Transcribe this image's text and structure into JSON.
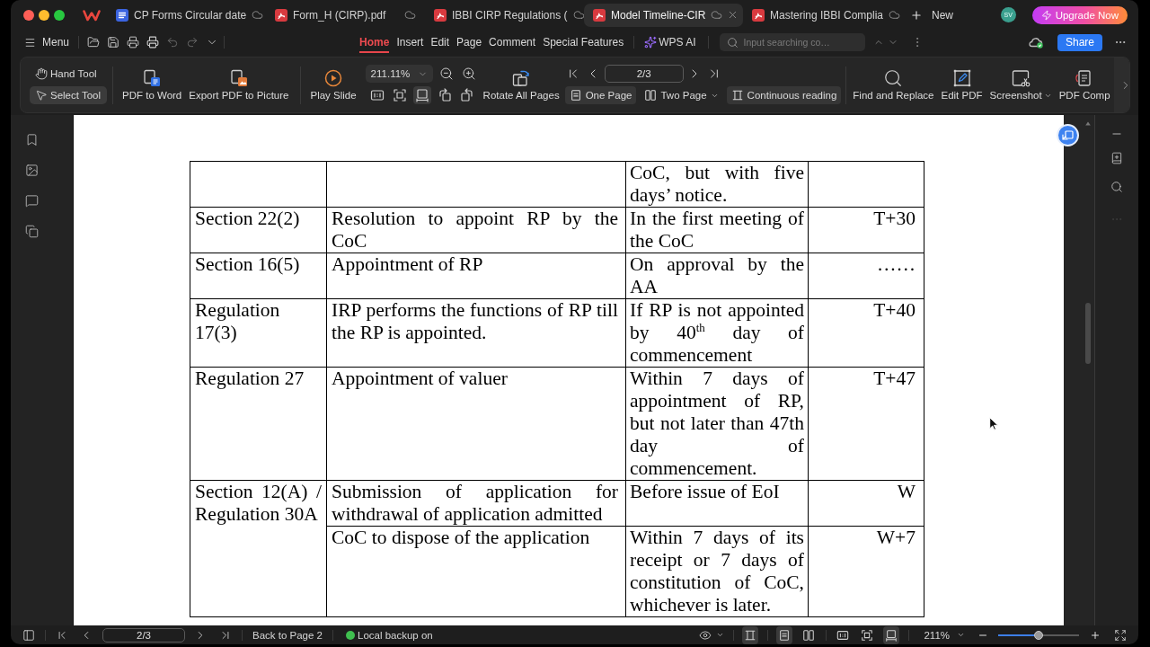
{
  "tabs": [
    {
      "label": "CP Forms Circular date",
      "kind": "word",
      "selected": false
    },
    {
      "label": "Form_H (CIRP).pdf",
      "kind": "pdf",
      "selected": false
    },
    {
      "label": "IBBI CIRP Regulations (",
      "kind": "pdf",
      "selected": false
    },
    {
      "label": "Model Timeline-CIR",
      "kind": "pdf",
      "selected": true
    },
    {
      "label": "Mastering IBBI Complia",
      "kind": "pdf",
      "selected": false
    }
  ],
  "new_tab": "New",
  "account": "SV",
  "upgrade_button": "Upgrade Now",
  "menu_button": "Menu",
  "ribbon_tabs": [
    {
      "label": "Home",
      "selected": true
    },
    {
      "label": "Insert",
      "selected": false
    },
    {
      "label": "Edit",
      "selected": false
    },
    {
      "label": "Page",
      "selected": false
    },
    {
      "label": "Comment",
      "selected": false
    },
    {
      "label": "Special Features",
      "selected": false
    }
  ],
  "ai_button": "WPS AI",
  "search": {
    "placeholder": "Input searching co…"
  },
  "share_button": "Share",
  "toolbar": {
    "pointer_tools": [
      {
        "label": "Hand Tool",
        "kind": "hand",
        "selected": false
      },
      {
        "label": "Select Tool",
        "kind": "select",
        "selected": true
      }
    ],
    "convert_buttons": [
      {
        "label": "PDF to Word",
        "kind": "word"
      },
      {
        "label": "Export PDF to Picture",
        "kind": "picture"
      }
    ],
    "play_button": "Play Slide",
    "zoom": "211.11%",
    "view_icons": [
      {
        "kind": "actual-size",
        "selected": false
      },
      {
        "kind": "fit-page",
        "selected": false
      },
      {
        "kind": "fit-width",
        "selected": true
      },
      {
        "kind": "rotate-left",
        "selected": false
      },
      {
        "kind": "rotate-right",
        "selected": false
      }
    ],
    "rotate_button": "Rotate All Pages",
    "page": "2/3",
    "page_layouts": [
      {
        "label": "One Page",
        "kind": "single",
        "selected": true,
        "dropdown": false
      },
      {
        "label": "Two Page",
        "kind": "double",
        "selected": false,
        "dropdown": true
      },
      {
        "label": "Continuous reading",
        "kind": "continuous",
        "selected": true,
        "dropdown": false
      }
    ],
    "tools": [
      {
        "label": "Find and Replace",
        "kind": "find",
        "dropdown": false
      },
      {
        "label": "Edit PDF",
        "kind": "edit",
        "dropdown": false
      },
      {
        "label": "Screenshot",
        "kind": "screenshot",
        "dropdown": true
      },
      {
        "label": "PDF Comp",
        "kind": "compress",
        "dropdown": false
      }
    ]
  },
  "table": {
    "groups": [
      {
        "entries": [
          {
            "timeline": "CoC, but with five days’ notice."
          }
        ]
      },
      {
        "reference": "Section 22(2)",
        "entries": [
          {
            "activity": "Resolution to appoint RP by the CoC",
            "timeline": "In the first meeting of the CoC",
            "day": "T+30"
          }
        ]
      },
      {
        "reference": "Section 16(5)",
        "entries": [
          {
            "activity": "Appointment of RP",
            "timeline": "On approval by the AA",
            "day": "……"
          }
        ]
      },
      {
        "reference": "Regulation 17(3)",
        "entries": [
          {
            "activity": "IRP performs the functions of RP till the RP is appointed.",
            "timeline": "If RP is not appointed by 40$^{th}$ day of commencement",
            "day": "T+40"
          }
        ]
      },
      {
        "reference": "Regulation 27",
        "entries": [
          {
            "activity": "Appointment of valuer",
            "timeline": "Within 7 days of appointment of RP, but not later than 47th day of commencement.",
            "day": "T+47"
          }
        ]
      },
      {
        "reference": "Section 12(A) / Regulation 30A",
        "entries": [
          {
            "activity": "Submission of application for withdrawal of application admitted",
            "timeline": "Before issue of EoI",
            "day": "W"
          },
          {
            "activity": "CoC to dispose of the application",
            "timeline": "Within 7 days of its receipt or 7 days of constitution of CoC, whichever is later.",
            "day": "W+7"
          }
        ]
      }
    ]
  },
  "status_bar": {
    "page": "2/3",
    "back_link": "Back to Page 2",
    "backup": "Local backup on",
    "view_groups": [
      {
        "icons": [
          {
            "kind": "continuous",
            "selected": true
          }
        ]
      },
      {
        "icons": [
          {
            "kind": "single",
            "selected": true
          },
          {
            "kind": "double",
            "selected": false
          }
        ]
      },
      {
        "icons": [
          {
            "kind": "actual-size",
            "selected": false
          },
          {
            "kind": "fit-page",
            "selected": false
          },
          {
            "kind": "fit-width",
            "selected": true
          }
        ]
      }
    ],
    "zoom": "211%",
    "zoom_slider": {
      "level": 0.5
    }
  }
}
